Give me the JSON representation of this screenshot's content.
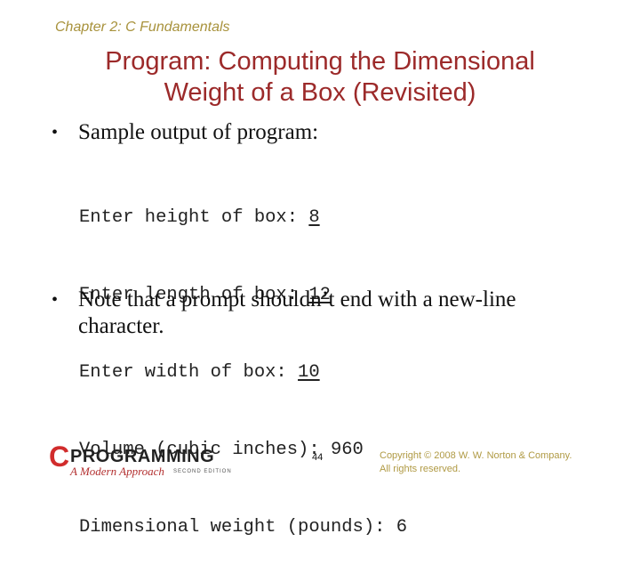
{
  "header": {
    "chapter": "Chapter 2: C Fundamentals"
  },
  "title": {
    "line1": "Program: Computing the Dimensional",
    "line2": "Weight of a Box (Revisited)"
  },
  "bullets": [
    {
      "text": "Sample output of program:"
    },
    {
      "line1": "Note that a prompt shouldn’t end with a new-line",
      "line2": "character."
    }
  ],
  "code_output": [
    {
      "prompt": "Enter height of box: ",
      "input": "8"
    },
    {
      "prompt": "Enter length of box: ",
      "input": "12"
    },
    {
      "prompt": "Enter width of box: ",
      "input": "10"
    },
    {
      "prompt": "Volume (cubic inches): 960",
      "input": ""
    },
    {
      "prompt": "Dimensional weight (pounds): 6",
      "input": ""
    }
  ],
  "footer": {
    "logo": {
      "letter": "C",
      "word": "PROGRAMMING",
      "subtitle": "A Modern Approach",
      "edition": "SECOND EDITION"
    },
    "page_number": "44",
    "copyright_line1": "Copyright © 2008 W. W. Norton & Company.",
    "copyright_line2": "All rights reserved."
  }
}
